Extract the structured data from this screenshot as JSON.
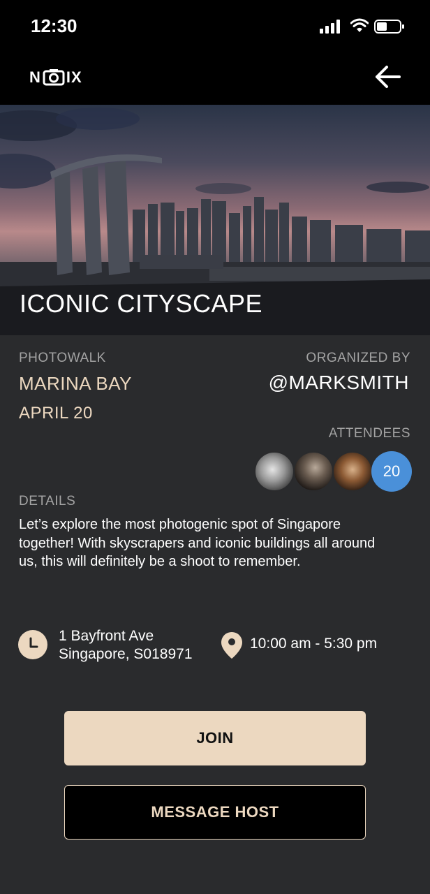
{
  "status": {
    "time": "12:30"
  },
  "nav": {
    "logo_left": "N",
    "logo_right": "IX"
  },
  "event": {
    "title": "ICONIC CITYSCAPE",
    "category": "PHOTOWALK",
    "location_name": "MARINA BAY",
    "date": "APRIL 20",
    "organized_by_label": "ORGANIZED BY",
    "organizer": "@MARKSMITH",
    "attendees_label": "ATTENDEES",
    "attendee_count": "20",
    "details_label": "DETAILS",
    "details": "Let’s explore the most photogenic spot of Singapore together! With skyscrapers and iconic buildings all around us, this will definitely be a shoot to remember.",
    "address_line1": "1 Bayfront Ave",
    "address_line2": "Singapore, S018971",
    "hours": "10:00 am - 5:30 pm"
  },
  "actions": {
    "join_label": "JOIN",
    "message_label": "MESSAGE HOST"
  },
  "colors": {
    "accent": "#ecd8c0",
    "background": "#2a2b2d",
    "badge": "#4a90d9"
  }
}
